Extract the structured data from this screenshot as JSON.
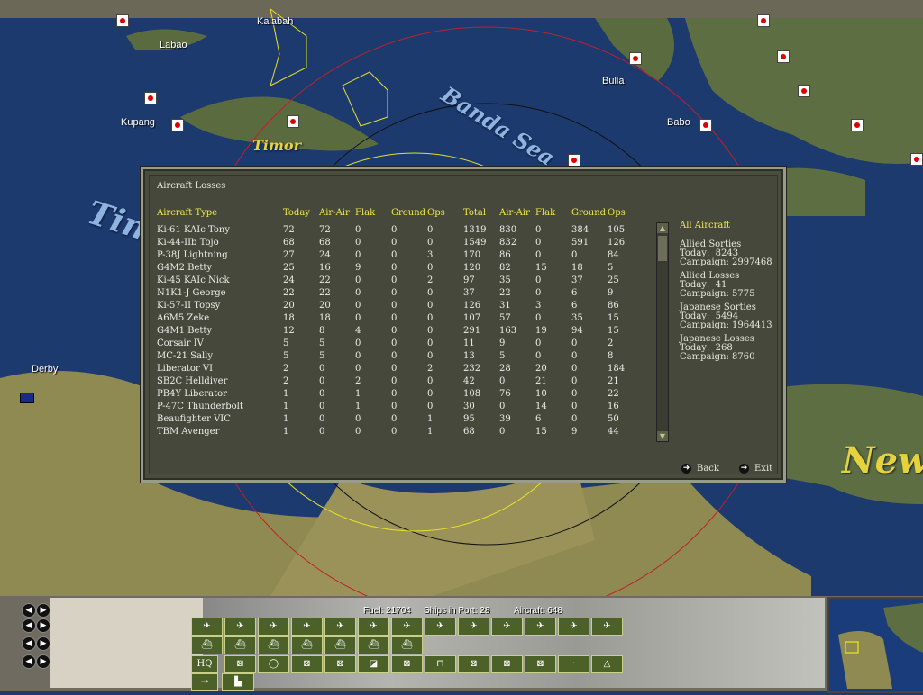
{
  "map": {
    "places": [
      "Kalabah",
      "Labao",
      "Kupang",
      "Bulla",
      "Babo",
      "Derby"
    ],
    "seas": {
      "banda": "Banda Sea",
      "timor_island": "Timor",
      "timor_sea": "Tim",
      "new": "New"
    }
  },
  "panel": {
    "title": "Aircraft Losses",
    "headers": [
      "Aircraft Type",
      "Today",
      "Air-Air",
      "Flak",
      "Ground",
      "Ops",
      "Total",
      "Air-Air",
      "Flak",
      "Ground",
      "Ops"
    ],
    "rows": [
      [
        "Ki-61 KAIc Tony",
        "72",
        "72",
        "0",
        "0",
        "0",
        "1319",
        "830",
        "0",
        "384",
        "105"
      ],
      [
        "Ki-44-IIb Tojo",
        "68",
        "68",
        "0",
        "0",
        "0",
        "1549",
        "832",
        "0",
        "591",
        "126"
      ],
      [
        "P-38J Lightning",
        "27",
        "24",
        "0",
        "0",
        "3",
        "170",
        "86",
        "0",
        "0",
        "84"
      ],
      [
        "G4M2 Betty",
        "25",
        "16",
        "9",
        "0",
        "0",
        "120",
        "82",
        "15",
        "18",
        "5"
      ],
      [
        "Ki-45 KAIc Nick",
        "24",
        "22",
        "0",
        "0",
        "2",
        "97",
        "35",
        "0",
        "37",
        "25"
      ],
      [
        "N1K1-J George",
        "22",
        "22",
        "0",
        "0",
        "0",
        "37",
        "22",
        "0",
        "6",
        "9"
      ],
      [
        "Ki-57-II Topsy",
        "20",
        "20",
        "0",
        "0",
        "0",
        "126",
        "31",
        "3",
        "6",
        "86"
      ],
      [
        "A6M5 Zeke",
        "18",
        "18",
        "0",
        "0",
        "0",
        "107",
        "57",
        "0",
        "35",
        "15"
      ],
      [
        "G4M1 Betty",
        "12",
        "8",
        "4",
        "0",
        "0",
        "291",
        "163",
        "19",
        "94",
        "15"
      ],
      [
        "Corsair IV",
        "5",
        "5",
        "0",
        "0",
        "0",
        "11",
        "9",
        "0",
        "0",
        "2"
      ],
      [
        "MC-21 Sally",
        "5",
        "5",
        "0",
        "0",
        "0",
        "13",
        "5",
        "0",
        "0",
        "8"
      ],
      [
        "Liberator VI",
        "2",
        "0",
        "0",
        "0",
        "2",
        "232",
        "28",
        "20",
        "0",
        "184"
      ],
      [
        "SB2C Helldiver",
        "2",
        "0",
        "2",
        "0",
        "0",
        "42",
        "0",
        "21",
        "0",
        "21"
      ],
      [
        "PB4Y Liberator",
        "1",
        "0",
        "1",
        "0",
        "0",
        "108",
        "76",
        "10",
        "0",
        "22"
      ],
      [
        "P-47C Thunderbolt",
        "1",
        "0",
        "1",
        "0",
        "0",
        "30",
        "0",
        "14",
        "0",
        "16"
      ],
      [
        "Beaufighter VIC",
        "1",
        "0",
        "0",
        "0",
        "1",
        "95",
        "39",
        "6",
        "0",
        "50"
      ],
      [
        "TBM Avenger",
        "1",
        "0",
        "0",
        "0",
        "1",
        "68",
        "0",
        "15",
        "9",
        "44"
      ]
    ],
    "side": {
      "heading": "All Aircraft",
      "allied_sorties": "Allied Sorties\nToday:  8243\nCampaign: 2997468",
      "allied_losses": "Allied Losses\nToday:  41\nCampaign: 5775",
      "japanese_sorties": "Japanese Sorties\nToday:  5494\nCampaign: 1964413",
      "japanese_losses": "Japanese Losses\nToday:  268\nCampaign: 8760"
    },
    "back_label": "Back",
    "exit_label": "Exit"
  },
  "status": {
    "fuel": "Fuel: 21704",
    "ships_port": "Ships in Port: 28",
    "aircraft": "Aircraft: 648"
  },
  "toolbar": {
    "ground_label": "HQ"
  },
  "colors": {
    "panel_bg": "#46483b",
    "header_yellow": "#f2e84a",
    "toolbar_green": "#4b6128"
  }
}
